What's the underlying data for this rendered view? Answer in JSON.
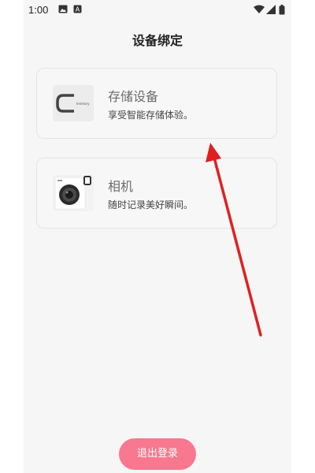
{
  "status_bar": {
    "time": "1:00"
  },
  "page": {
    "title": "设备绑定"
  },
  "devices": [
    {
      "title": "存储设备",
      "subtitle": "享受智能存储体验。",
      "thumb_text": "lenmory",
      "icon": "storage-device-icon"
    },
    {
      "title": "相机",
      "subtitle": "随时记录美好瞬间。",
      "icon": "camera-icon"
    }
  ],
  "logout": {
    "label": "退出登录"
  },
  "colors": {
    "logout_bg": "#f7788f",
    "annotation_arrow": "#e02020"
  }
}
